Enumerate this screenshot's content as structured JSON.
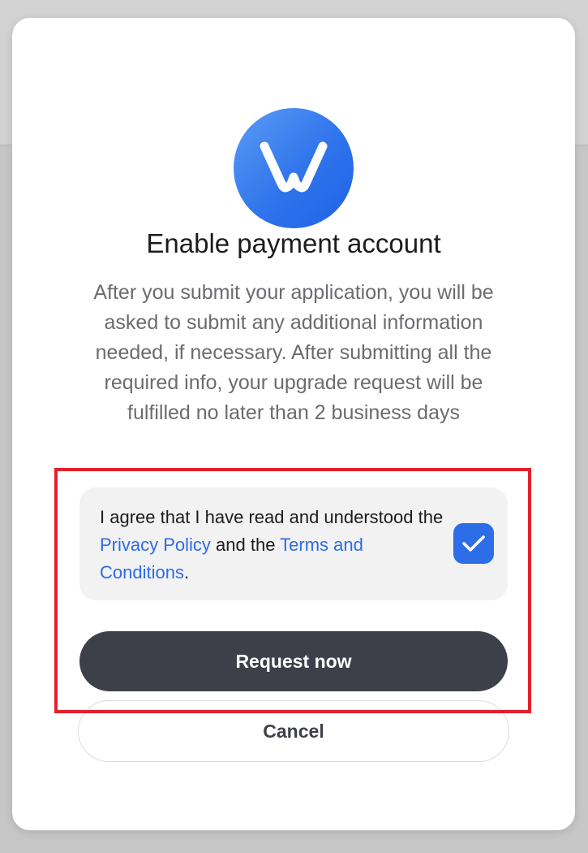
{
  "dialog": {
    "title": "Enable payment account",
    "description": "After you submit your application, you will be asked to submit any additional information needed, if necessary. After submitting all the required info, your upgrade request will be fulfilled no later than 2 business days"
  },
  "consent": {
    "text_before": "I agree that I have read and understood the ",
    "privacy_link": "Privacy Policy",
    "text_middle": " and the ",
    "terms_link": "Terms and Conditions",
    "text_after": ".",
    "checked": true,
    "check_icon": "check-icon"
  },
  "buttons": {
    "primary_label": "Request now",
    "secondary_label": "Cancel"
  },
  "logo": {
    "icon": "w-logo-icon"
  },
  "colors": {
    "brand_blue": "#2d6de8",
    "link_blue": "#2e6be6",
    "primary_button": "#3e4049",
    "highlight_red": "#e4202a"
  }
}
